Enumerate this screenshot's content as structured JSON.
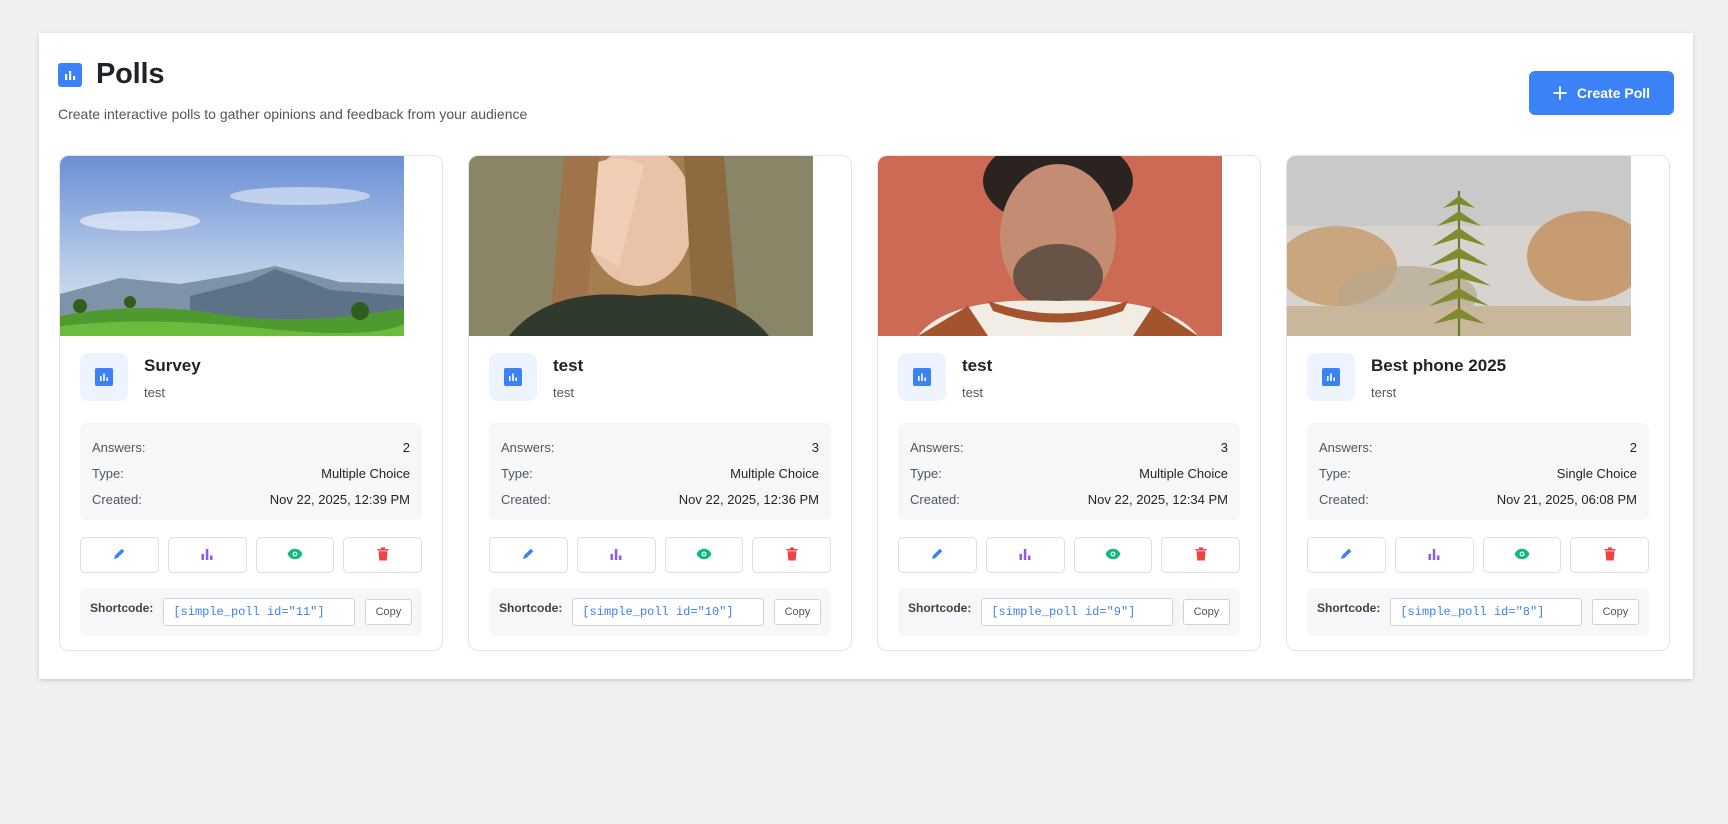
{
  "header": {
    "title": "Polls",
    "subtitle": "Create interactive polls to gather opinions and feedback from your audience",
    "create_label": "Create Poll",
    "accent": "#3b82f6"
  },
  "labels": {
    "answers": "Answers:",
    "type": "Type:",
    "created": "Created:",
    "shortcode": "Shortcode:",
    "copy": "Copy"
  },
  "polls": [
    {
      "title": "Survey",
      "description": "test",
      "answers": "2",
      "type": "Multiple Choice",
      "created": "Nov 22, 2025, 12:39 PM",
      "shortcode": "[simple_poll id=\"11\"]",
      "image": "mountain-landscape"
    },
    {
      "title": "test",
      "description": "test",
      "answers": "3",
      "type": "Multiple Choice",
      "created": "Nov 22, 2025, 12:36 PM",
      "shortcode": "[simple_poll id=\"10\"]",
      "image": "woman-covering-face"
    },
    {
      "title": "test",
      "description": "test",
      "answers": "3",
      "type": "Multiple Choice",
      "created": "Nov 22, 2025, 12:34 PM",
      "shortcode": "[simple_poll id=\"9\"]",
      "image": "man-red-wall"
    },
    {
      "title": "Best phone 2025",
      "description": "terst",
      "answers": "2",
      "type": "Single Choice",
      "created": "Nov 21, 2025, 06:08 PM",
      "shortcode": "[simple_poll id=\"8\"]",
      "image": "fern-leaf"
    }
  ],
  "action_icons": {
    "edit": {
      "icon": "pencil-icon",
      "color": "#3b82f6"
    },
    "results": {
      "icon": "bar-chart-icon",
      "color": "#8b5cf6"
    },
    "preview": {
      "icon": "eye-icon",
      "color": "#10b981"
    },
    "delete": {
      "icon": "trash-icon",
      "color": "#ef4444"
    }
  }
}
